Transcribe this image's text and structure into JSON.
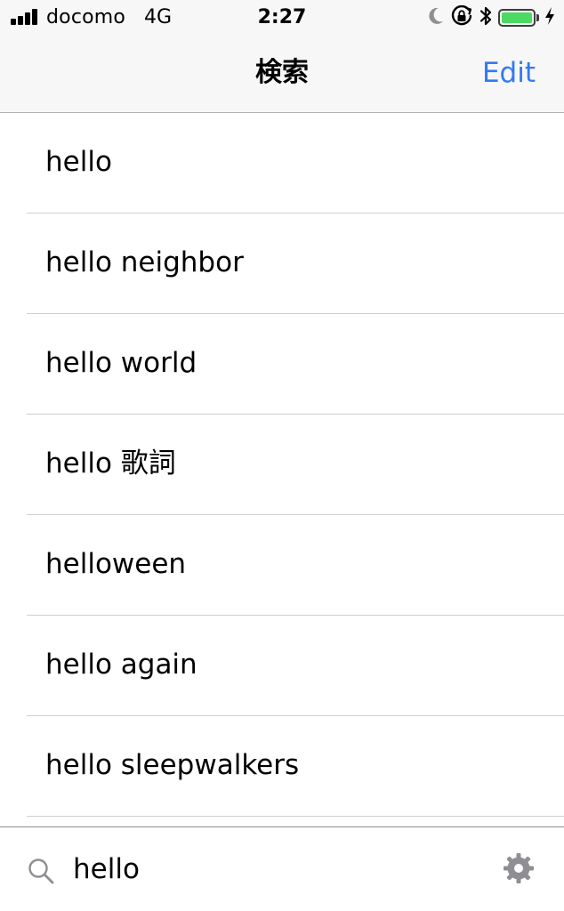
{
  "status_bar": {
    "carrier": "docomo",
    "network": "4G",
    "time": "2:27",
    "battery_level": 1.0,
    "battery_color": "#4cd964",
    "icons": [
      "signal-icon",
      "moon-icon",
      "orientation-lock-icon",
      "bluetooth-icon",
      "battery-icon",
      "charging-icon"
    ]
  },
  "nav": {
    "title": "検索",
    "edit_label": "Edit",
    "accent_color": "#3478f6"
  },
  "suggestions": [
    "hello",
    "hello neighbor",
    "hello world",
    "hello 歌詞",
    "helloween",
    "hello again",
    "hello sleepwalkers"
  ],
  "search": {
    "value": "hello",
    "icon": "search-icon",
    "settings_icon": "gear-icon"
  }
}
